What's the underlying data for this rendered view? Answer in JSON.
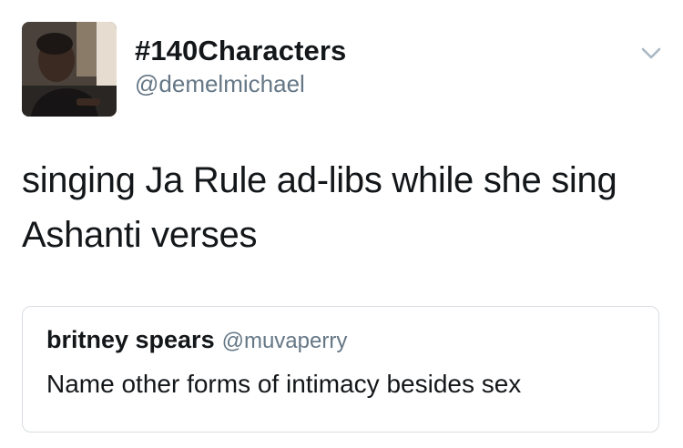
{
  "tweet": {
    "author": {
      "display_name": "#140Characters",
      "handle": "@demelmichael",
      "avatar_icon": "profile-photo"
    },
    "menu_icon": "chevron-down-icon",
    "text": "singing Ja Rule ad-libs while she sing Ashanti verses",
    "quoted_tweet": {
      "display_name": "britney spears",
      "handle": "@muvaperry",
      "text": "Name other forms of intimacy besides sex"
    }
  },
  "colors": {
    "primary_text": "#14171a",
    "secondary_text": "#657786",
    "card_border": "#d8dde2",
    "caret": "#aab8c2"
  }
}
